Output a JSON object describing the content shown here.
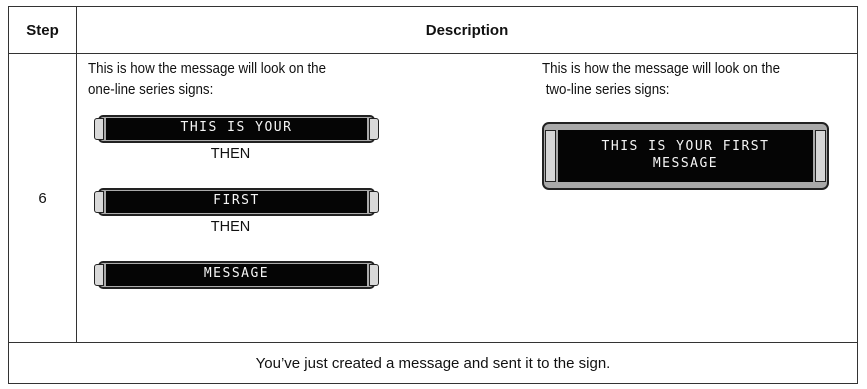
{
  "table": {
    "headers": {
      "step": "Step",
      "description": "Description"
    },
    "rows": [
      {
        "step": "6",
        "left": {
          "intro_line1": "This is how the message will look on the",
          "intro_line2": "one-line series signs:",
          "signs": [
            "THIS IS YOUR",
            "FIRST",
            "MESSAGE"
          ],
          "then_label": "THEN"
        },
        "right": {
          "intro_line1": "This is how the message will look on the",
          "intro_line2": " two-line series signs:",
          "sign_line1": "THIS IS YOUR FIRST",
          "sign_line2": "MESSAGE"
        }
      }
    ],
    "footer": "You’ve just created a message and sent it to the sign."
  }
}
